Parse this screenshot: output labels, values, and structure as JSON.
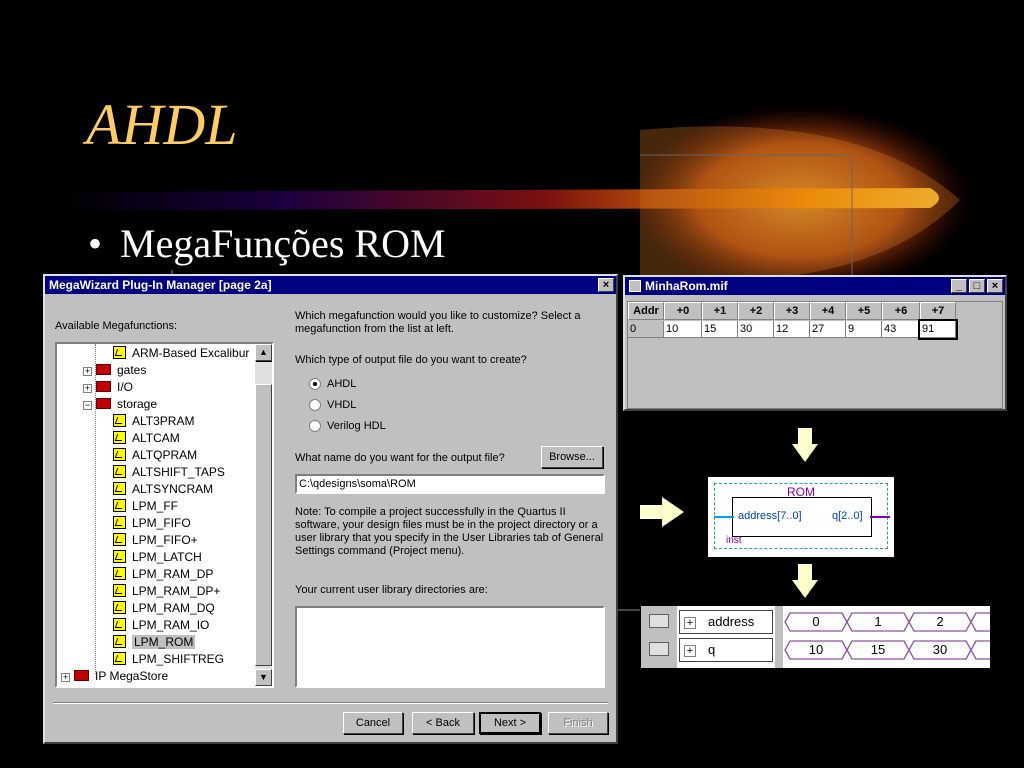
{
  "slide": {
    "title": "AHDL",
    "bullet_mark": "•",
    "bullet_text": "MegaFunções ROM",
    "accent_color": "#ffcc66"
  },
  "wizard": {
    "title": "MegaWizard Plug-In Manager [page 2a]",
    "close_label": "×",
    "available_label": "Available Megafunctions:",
    "tree_items": [
      {
        "label": "ARM-Based Excalibur",
        "kind": "file",
        "level": 1
      },
      {
        "label": "gates",
        "kind": "folder",
        "level": 0,
        "toggle": "+"
      },
      {
        "label": "I/O",
        "kind": "folder",
        "level": 0,
        "toggle": "+"
      },
      {
        "label": "storage",
        "kind": "folder",
        "level": 0,
        "toggle": "−"
      },
      {
        "label": "ALT3PRAM",
        "kind": "file",
        "level": 1
      },
      {
        "label": "ALTCAM",
        "kind": "file",
        "level": 1
      },
      {
        "label": "ALTQPRAM",
        "kind": "file",
        "level": 1
      },
      {
        "label": "ALTSHIFT_TAPS",
        "kind": "file",
        "level": 1
      },
      {
        "label": "ALTSYNCRAM",
        "kind": "file",
        "level": 1
      },
      {
        "label": "LPM_FF",
        "kind": "file",
        "level": 1
      },
      {
        "label": "LPM_FIFO",
        "kind": "file",
        "level": 1
      },
      {
        "label": "LPM_FIFO+",
        "kind": "file",
        "level": 1
      },
      {
        "label": "LPM_LATCH",
        "kind": "file",
        "level": 1
      },
      {
        "label": "LPM_RAM_DP",
        "kind": "file",
        "level": 1
      },
      {
        "label": "LPM_RAM_DP+",
        "kind": "file",
        "level": 1
      },
      {
        "label": "LPM_RAM_DQ",
        "kind": "file",
        "level": 1
      },
      {
        "label": "LPM_RAM_IO",
        "kind": "file",
        "level": 1
      },
      {
        "label": "LPM_ROM",
        "kind": "file",
        "level": 1,
        "selected": true
      },
      {
        "label": "LPM_SHIFTREG",
        "kind": "file",
        "level": 1
      },
      {
        "label": "IP MegaStore",
        "kind": "folder",
        "level": -1,
        "toggle": "+"
      }
    ],
    "question1": "Which megafunction would you like to customize? Select a megafunction from the list at left.",
    "question2": "Which type of output file do you want to create?",
    "output_options": [
      {
        "label": "AHDL",
        "checked": true
      },
      {
        "label": "VHDL",
        "checked": false
      },
      {
        "label": "Verilog HDL",
        "checked": false
      }
    ],
    "name_question": "What name do you want for the output file?",
    "browse_label": "Browse...",
    "output_path": "C:\\qdesigns\\soma\\ROM",
    "note": "Note: To compile a project successfully in the Quartus II software, your design files must be in the project directory or a user library that you specify in the User Libraries tab of General Settings command (Project menu).",
    "libraries_label": "Your current user library directories are:",
    "buttons": {
      "cancel": "Cancel",
      "back": "< Back",
      "next": "Next >",
      "finish": "Finish"
    }
  },
  "mif": {
    "title": "MinhaRom.mif",
    "controls": [
      "_",
      "□",
      "×"
    ],
    "headers": [
      "Addr",
      "+0",
      "+1",
      "+2",
      "+3",
      "+4",
      "+5",
      "+6",
      "+7"
    ],
    "row": [
      "0",
      "10",
      "15",
      "30",
      "12",
      "27",
      "9",
      "43",
      "91"
    ]
  },
  "symbol": {
    "name": "ROM",
    "input_port": "address[7..0]",
    "output_port": "q[2..0]",
    "instance": "inst",
    "input_color": "#00a0ff",
    "output_color": "#8000c0"
  },
  "waveform": {
    "rows": [
      {
        "name": "address",
        "toggle": "+",
        "values": [
          "0",
          "1",
          "2"
        ]
      },
      {
        "name": "q",
        "toggle": "+",
        "values": [
          "10",
          "15",
          "30"
        ]
      }
    ]
  }
}
